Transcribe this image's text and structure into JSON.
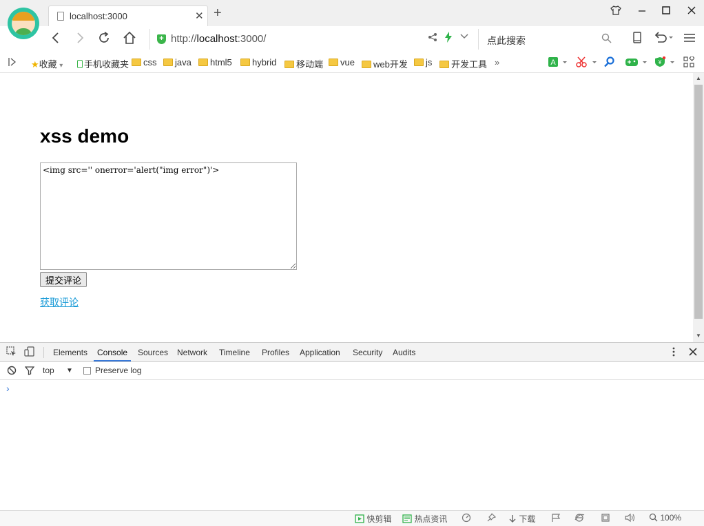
{
  "browser": {
    "tab_title": "localhost:3000",
    "tab_close": "✕",
    "new_tab": "+",
    "url_prefix": "http://",
    "url_host": "localhost",
    "url_suffix": ":3000/",
    "search_placeholder": "点此搜索"
  },
  "bookmarks": {
    "favorites": "收藏",
    "mobile_favorites": "手机收藏夹",
    "folders": [
      "css",
      "java",
      "html5",
      "hybrid",
      "移动端",
      "vue",
      "web开发",
      "js",
      "开发工具"
    ],
    "more": "»"
  },
  "page": {
    "heading": "xss demo",
    "textarea_value": "<img src='' onerror='alert(\"img error\")'>",
    "submit_label": "提交评论",
    "get_link": "获取评论"
  },
  "devtools": {
    "tabs": [
      "Elements",
      "Console",
      "Sources",
      "Network",
      "Timeline",
      "Profiles",
      "Application",
      "Security",
      "Audits"
    ],
    "active_tab": "Console",
    "context": "top",
    "preserve_log": "Preserve log",
    "prompt": "›"
  },
  "statusbar": {
    "clip": "快剪辑",
    "news": "热点资讯",
    "download": "下载",
    "zoom": "100%"
  },
  "colors": {
    "accent": "#3879d9",
    "link": "#1a9bd7",
    "secure": "#3bb54a"
  }
}
